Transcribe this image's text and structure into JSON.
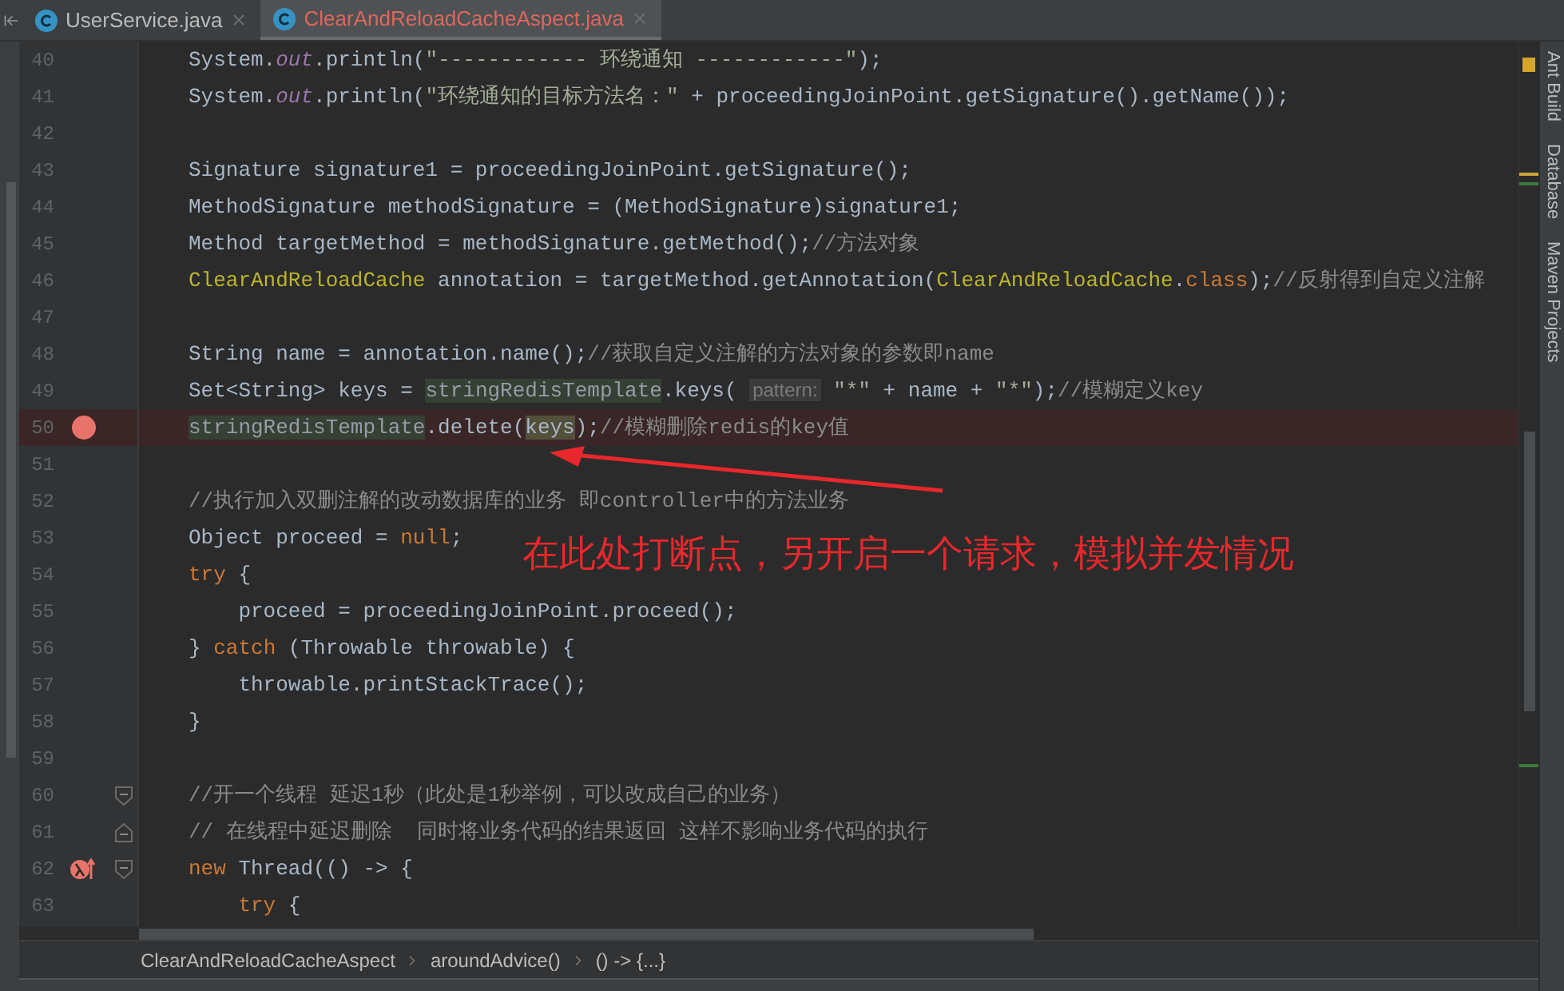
{
  "tabs": [
    {
      "label": "UserService.java",
      "selected": false
    },
    {
      "label": "ClearAndReloadCacheAspect.java",
      "selected": true
    }
  ],
  "editor": {
    "lines": [
      {
        "number": "40",
        "segments": [
          {
            "kind": "plain",
            "text": "System."
          },
          {
            "kind": "static",
            "text": "out"
          },
          {
            "kind": "plain",
            "text": ".println("
          },
          {
            "kind": "string",
            "text": "\"------------ 环绕通知 ------------\""
          },
          {
            "kind": "plain",
            "text": ");"
          }
        ]
      },
      {
        "number": "41",
        "segments": [
          {
            "kind": "plain",
            "text": "System."
          },
          {
            "kind": "static",
            "text": "out"
          },
          {
            "kind": "plain",
            "text": ".println("
          },
          {
            "kind": "string",
            "text": "\"环绕通知的目标方法名：\""
          },
          {
            "kind": "plain",
            "text": " + proceedingJoinPoint.getSignature().getName());"
          }
        ]
      },
      {
        "number": "42"
      },
      {
        "number": "43",
        "segments": [
          {
            "kind": "plain",
            "text": "Signature signature1 = proceedingJoinPoint.getSignature();"
          }
        ]
      },
      {
        "number": "44",
        "segments": [
          {
            "kind": "plain",
            "text": "MethodSignature methodSignature = (MethodSignature)signature1;"
          }
        ]
      },
      {
        "number": "45",
        "segments": [
          {
            "kind": "plain",
            "text": "Method targetMethod = methodSignature.getMethod();"
          },
          {
            "kind": "comment",
            "text": "//方法对象"
          }
        ]
      },
      {
        "number": "46",
        "segments": [
          {
            "kind": "annotation",
            "text": "ClearAndReloadCache"
          },
          {
            "kind": "plain",
            "text": " annotation = targetMethod.getAnnotation("
          },
          {
            "kind": "annotation",
            "text": "ClearAndReloadCache"
          },
          {
            "kind": "plain",
            "text": "."
          },
          {
            "kind": "keyword",
            "text": "class"
          },
          {
            "kind": "plain",
            "text": ");"
          },
          {
            "kind": "comment",
            "text": "//反射得到自定义注解"
          }
        ]
      },
      {
        "number": "47"
      },
      {
        "number": "48",
        "segments": [
          {
            "kind": "plain",
            "text": "String name = annotation.name();"
          },
          {
            "kind": "comment",
            "text": "//获取自定义注解的方法对象的参数即name"
          }
        ]
      },
      {
        "number": "49",
        "segments": [
          {
            "kind": "plain",
            "text": "Set<String> keys = "
          },
          {
            "kind": "usage",
            "text": "stringRedisTemplate"
          },
          {
            "kind": "plain",
            "text": ".keys( "
          },
          {
            "kind": "hint",
            "text": "pattern:"
          },
          {
            "kind": "string",
            "text": " \"*\""
          },
          {
            "kind": "plain",
            "text": " + name + "
          },
          {
            "kind": "string",
            "text": "\"*\""
          },
          {
            "kind": "plain",
            "text": ");"
          },
          {
            "kind": "comment",
            "text": "//模糊定义key"
          }
        ]
      },
      {
        "number": "50",
        "breakpoint": true,
        "segments": [
          {
            "kind": "usage",
            "text": "stringRedisTemplate"
          },
          {
            "kind": "plain",
            "text": ".delete("
          },
          {
            "kind": "read_usage",
            "text": "keys"
          },
          {
            "kind": "plain",
            "text": ");"
          },
          {
            "kind": "comment",
            "text": "//模糊删除redis的key值"
          }
        ]
      },
      {
        "number": "51"
      },
      {
        "number": "52",
        "segments": [
          {
            "kind": "comment",
            "text": "//执行加入双删注解的改动数据库的业务 即controller中的方法业务"
          }
        ]
      },
      {
        "number": "53",
        "segments": [
          {
            "kind": "plain",
            "text": "Object proceed = "
          },
          {
            "kind": "keyword",
            "text": "null"
          },
          {
            "kind": "plain",
            "text": ";"
          }
        ]
      },
      {
        "number": "54",
        "segments": [
          {
            "kind": "keyword",
            "text": "try"
          },
          {
            "kind": "plain",
            "text": " {"
          }
        ]
      },
      {
        "number": "55",
        "segments": [
          {
            "kind": "plain",
            "text": "    proceed = proceedingJoinPoint.proceed();"
          }
        ]
      },
      {
        "number": "56",
        "segments": [
          {
            "kind": "plain",
            "text": "} "
          },
          {
            "kind": "keyword",
            "text": "catch"
          },
          {
            "kind": "plain",
            "text": " (Throwable throwable) {"
          }
        ]
      },
      {
        "number": "57",
        "segments": [
          {
            "kind": "plain",
            "text": "    throwable.printStackTrace();"
          }
        ]
      },
      {
        "number": "58",
        "segments": [
          {
            "kind": "plain",
            "text": "}"
          }
        ]
      },
      {
        "number": "59"
      },
      {
        "number": "60",
        "fold_start": true,
        "segments": [
          {
            "kind": "comment",
            "text": "//开一个线程 延迟1秒（此处是1秒举例，可以改成自己的业务）"
          }
        ]
      },
      {
        "number": "61",
        "fold_end": true,
        "segments": [
          {
            "kind": "comment",
            "text": "// 在线程中延迟删除  同时将业务代码的结果返回 这样不影响业务代码的执行"
          }
        ]
      },
      {
        "number": "62",
        "lambda_breakpoint": true,
        "fold_start": true,
        "segments": [
          {
            "kind": "keyword",
            "text": "new"
          },
          {
            "kind": "plain",
            "text": " Thread(() -> {"
          }
        ]
      },
      {
        "number": "63",
        "segments": [
          {
            "kind": "keyword",
            "text": "    try"
          },
          {
            "kind": "plain",
            "text": " {"
          }
        ]
      }
    ]
  },
  "annotation_note": {
    "text": "在此处打断点，另开启一个请求，模拟并发情况"
  },
  "breadcrumbs": [
    "ClearAndReloadCacheAspect",
    "aroundAdvice()",
    "() -> {...}"
  ],
  "tool_windows": [
    "Ant Build",
    "Database",
    "Maven Projects"
  ]
}
